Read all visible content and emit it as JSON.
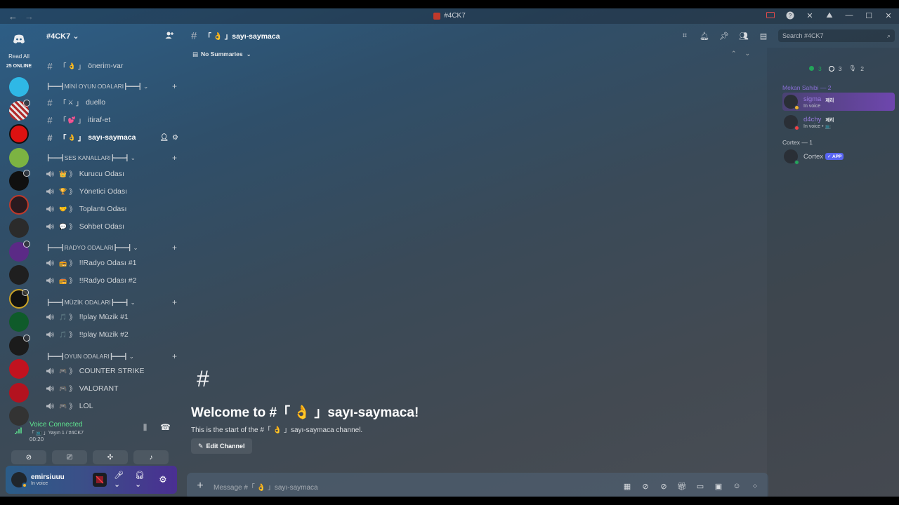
{
  "window": {
    "title": "#4CK7"
  },
  "rail": {
    "read_all": "Read All",
    "online": "25 ONLINE"
  },
  "guild": {
    "name": "#4CK7"
  },
  "channels": [
    {
      "type": "text",
      "emoji": "👌",
      "name": "önerim-var"
    },
    {
      "type": "category",
      "name": "┣━━━┫MİNİ OYUN ODALARI┣━━━┫"
    },
    {
      "type": "text",
      "emoji": "⚔",
      "name": "duello"
    },
    {
      "type": "text",
      "emoji": "💕",
      "name": "itiraf-et"
    },
    {
      "type": "text",
      "emoji": "👌",
      "name": "sayı-saymaca",
      "active": true
    },
    {
      "type": "category",
      "name": "┣━━━┫SES KANALLARI┣━━━┫"
    },
    {
      "type": "voice",
      "emoji": "👑",
      "name": "Kurucu Odası"
    },
    {
      "type": "voice",
      "emoji": "🏆",
      "name": "Yönetici Odası"
    },
    {
      "type": "voice",
      "emoji": "🤝",
      "name": "Toplantı Odası"
    },
    {
      "type": "voice",
      "emoji": "💬",
      "name": "Sohbet Odası"
    },
    {
      "type": "category",
      "name": "┣━━━┫RADYO ODALARI┣━━━┫"
    },
    {
      "type": "voice",
      "emoji": "📻",
      "name": "!!Radyo Odası #1"
    },
    {
      "type": "voice",
      "emoji": "📻",
      "name": "!!Radyo Odası #2"
    },
    {
      "type": "category",
      "name": "┣━━━┫MÜZİK ODALARI┣━━━┫"
    },
    {
      "type": "voice",
      "emoji": "🎵",
      "name": "!!play Müzik #1"
    },
    {
      "type": "voice",
      "emoji": "🎵",
      "name": "!!play Müzik #2"
    },
    {
      "type": "category",
      "name": "┣━━━┫OYUN ODALARI┣━━━┫"
    },
    {
      "type": "voice",
      "emoji": "🎮",
      "name": "COUNTER STRIKE"
    },
    {
      "type": "voice",
      "emoji": "🎮",
      "name": "VALORANT"
    },
    {
      "type": "voice",
      "emoji": "🎮",
      "name": "LOL"
    }
  ],
  "voice": {
    "title": "Voice Connected",
    "sub": "「 📺 」Yayın 1 / #4CK7",
    "time": "00:20"
  },
  "user": {
    "name": "emirsiuuu",
    "status": "In voice"
  },
  "channel": {
    "name": "「 👌 」sayı-saymaca",
    "summaries": "No Summaries",
    "welcome_title": "Welcome to #「 👌 」sayı-saymaca!",
    "welcome_sub": "This is the start of the #「 👌 」sayı-saymaca channel.",
    "edit_button": "Edit Channel",
    "composer_placeholder": "Message #「 👌 」sayı-saymaca"
  },
  "search": {
    "placeholder": "Search #4CK7"
  },
  "members": {
    "status_counts": [
      "3",
      "3",
      "2"
    ],
    "groups": [
      {
        "title": "Mekan Sahibi — 2",
        "color": "#8a6fd6",
        "members": [
          {
            "name": "sigma",
            "tag": "제리",
            "sub": "In voice",
            "highlight": true,
            "status_color": "#f0b232"
          },
          {
            "name": "d4chy",
            "tag": "제리",
            "sub": "In voice • 📺",
            "highlight": false,
            "status_color": "#f23f43"
          }
        ]
      },
      {
        "title": "Cortex — 1",
        "color": "#c8ccd1",
        "members": [
          {
            "name": "Cortex",
            "tag": "✓ APP",
            "sub": "",
            "highlight": false,
            "status_color": "#23a55a"
          }
        ]
      }
    ]
  }
}
